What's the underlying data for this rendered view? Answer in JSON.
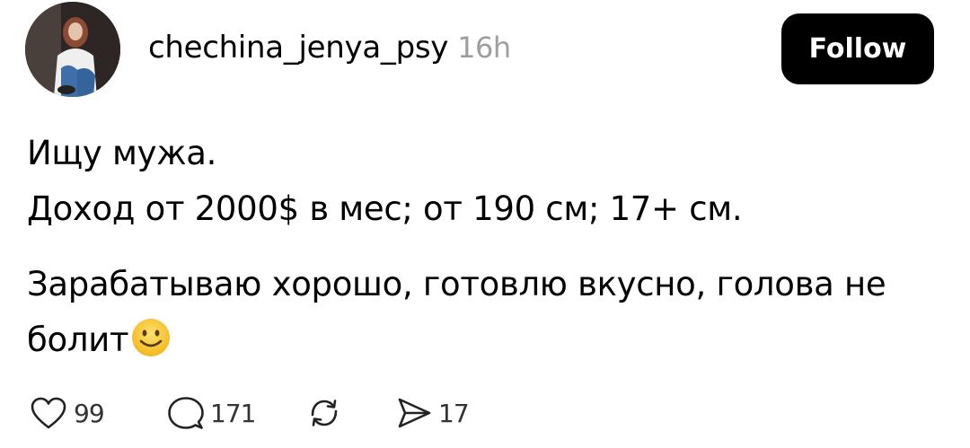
{
  "post": {
    "username": "chechina_jenya_psy",
    "timestamp": "16h",
    "follow_label": "Follow",
    "text_lines": [
      "Ищу мужа.",
      "Доход от 2000$ в мес; от 190 см; 17+ см."
    ],
    "text_para2": "Зарабатываю хорошо, готовлю вкусно, голова не болит",
    "emoji": "smiling-face-icon"
  },
  "actions": {
    "likes": "99",
    "replies": "171",
    "shares": "17"
  },
  "colors": {
    "follow_bg": "#000000",
    "follow_text": "#ffffff",
    "timestamp": "#9e9e9e",
    "emoji": "#f7c531"
  }
}
